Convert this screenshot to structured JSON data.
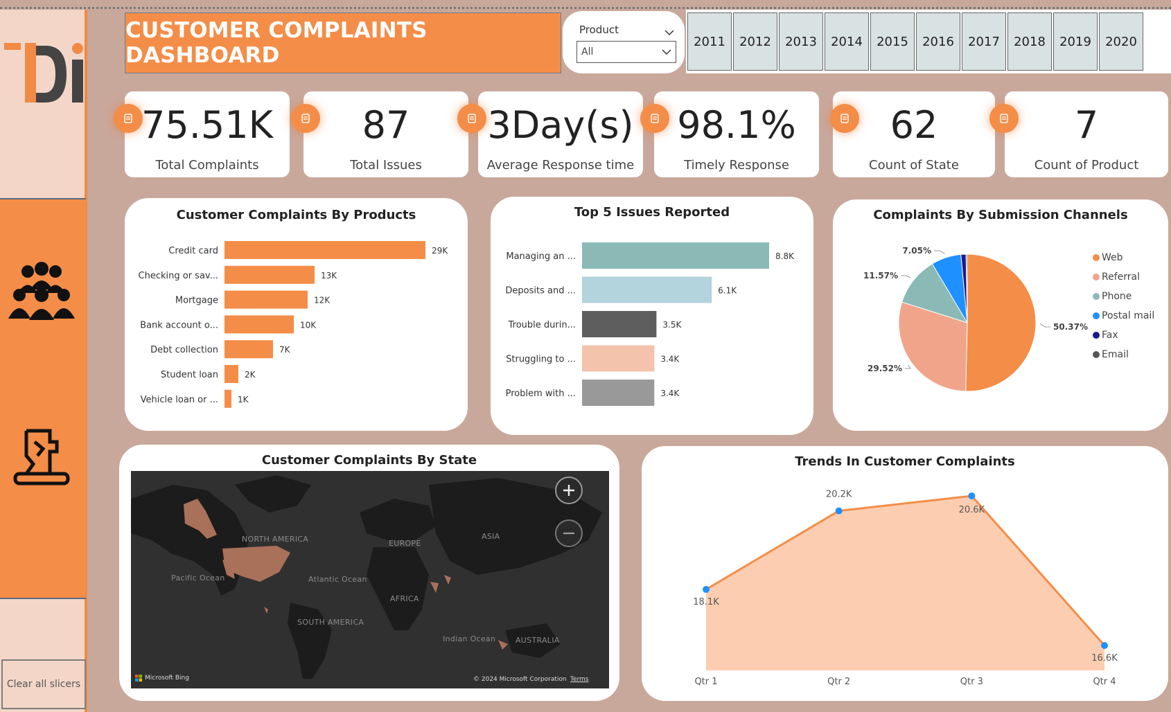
{
  "title": "CUSTOMER COMPLAINTS DASHBOARD",
  "sidebar": {
    "logo_icon": "tdi-logo",
    "nav": [
      {
        "icon": "people-group-icon"
      },
      {
        "icon": "complaint-person-icon"
      }
    ],
    "clear_label": "Clear all slicers"
  },
  "product_slicer": {
    "label": "Product",
    "value": "All"
  },
  "years": [
    "2011",
    "2012",
    "2013",
    "2014",
    "2015",
    "2016",
    "2017",
    "2018",
    "2019",
    "2020"
  ],
  "kpis": [
    {
      "value": "75.51K",
      "label": "Total Complaints",
      "icon": "hand-icon"
    },
    {
      "value": "87",
      "label": "Total Issues",
      "icon": "thumb-icon"
    },
    {
      "value": "3Day(s)",
      "label": "Average Response time",
      "icon": "printer-icon"
    },
    {
      "value": "98.1%",
      "label": "Timely Response",
      "icon": "phone-icon"
    },
    {
      "value": "62",
      "label": "Count of State",
      "icon": "capitol-building-icon"
    },
    {
      "value": "7",
      "label": "Count of Product",
      "icon": "document-icon"
    }
  ],
  "map": {
    "title": "Customer Complaints By State",
    "labels": [
      "NORTH AMERICA",
      "EUROPE",
      "ASIA",
      "AFRICA",
      "SOUTH AMERICA",
      "AUSTRALIA",
      "Pacific Ocean",
      "Atlantic Ocean",
      "Indian Ocean"
    ],
    "attribution": "Microsoft Bing",
    "copyright": "© 2024 Microsoft Corporation",
    "terms": "Terms"
  },
  "colors": {
    "accent": "#f48d47",
    "background": "#c9a89c",
    "sidebar": "#f3d6c8"
  },
  "chart_data": [
    {
      "type": "bar",
      "title": "Customer Complaints By Products",
      "orientation": "horizontal",
      "categories": [
        "Credit card",
        "Checking or sav...",
        "Mortgage",
        "Bank account o...",
        "Debt collection",
        "Student loan",
        "Vehicle loan or ..."
      ],
      "values": [
        29000,
        13000,
        12000,
        10000,
        7000,
        2000,
        1000
      ],
      "data_labels": [
        "29K",
        "13K",
        "12K",
        "10K",
        "7K",
        "2K",
        "1K"
      ],
      "color": "#f48d47"
    },
    {
      "type": "bar",
      "title": "Top 5 Issues Reported",
      "orientation": "horizontal",
      "categories": [
        "Managing an ...",
        "Deposits and ...",
        "Trouble durin...",
        "Struggling to ...",
        "Problem with ..."
      ],
      "values": [
        8800,
        6100,
        3500,
        3400,
        3400
      ],
      "data_labels": [
        "8.8K",
        "6.1K",
        "3.5K",
        "3.4K",
        "3.4K"
      ],
      "colors": [
        "#8bbab6",
        "#b3d3dd",
        "#5e5e5e",
        "#f4c3ac",
        "#999999"
      ]
    },
    {
      "type": "pie",
      "title": "Complaints By Submission Channels",
      "legend_position": "right",
      "slices": [
        {
          "name": "Web",
          "value": 50.37,
          "label": "50.37%",
          "color": "#f48d47"
        },
        {
          "name": "Referral",
          "value": 29.52,
          "label": "29.52%",
          "color": "#f0a58a"
        },
        {
          "name": "Phone",
          "value": 11.57,
          "label": "11.57%",
          "color": "#8bbab6"
        },
        {
          "name": "Postal mail",
          "value": 7.05,
          "label": "7.05%",
          "color": "#1e90ff"
        },
        {
          "name": "Fax",
          "value": 1.2,
          "label": "",
          "color": "#1a1a8c"
        },
        {
          "name": "Email",
          "value": 0.29,
          "label": "",
          "color": "#555555"
        }
      ]
    },
    {
      "type": "area",
      "title": "Trends In Customer Complaints",
      "categories": [
        "Qtr 1",
        "Qtr 2",
        "Qtr 3",
        "Qtr 4"
      ],
      "values": [
        18100,
        20200,
        20600,
        16600
      ],
      "data_labels": [
        "18.1K",
        "20.2K",
        "20.6K",
        "16.6K"
      ],
      "ylim": [
        16600,
        20600
      ],
      "line_color": "#f48d47",
      "fill_color": "#fccdb0"
    }
  ]
}
